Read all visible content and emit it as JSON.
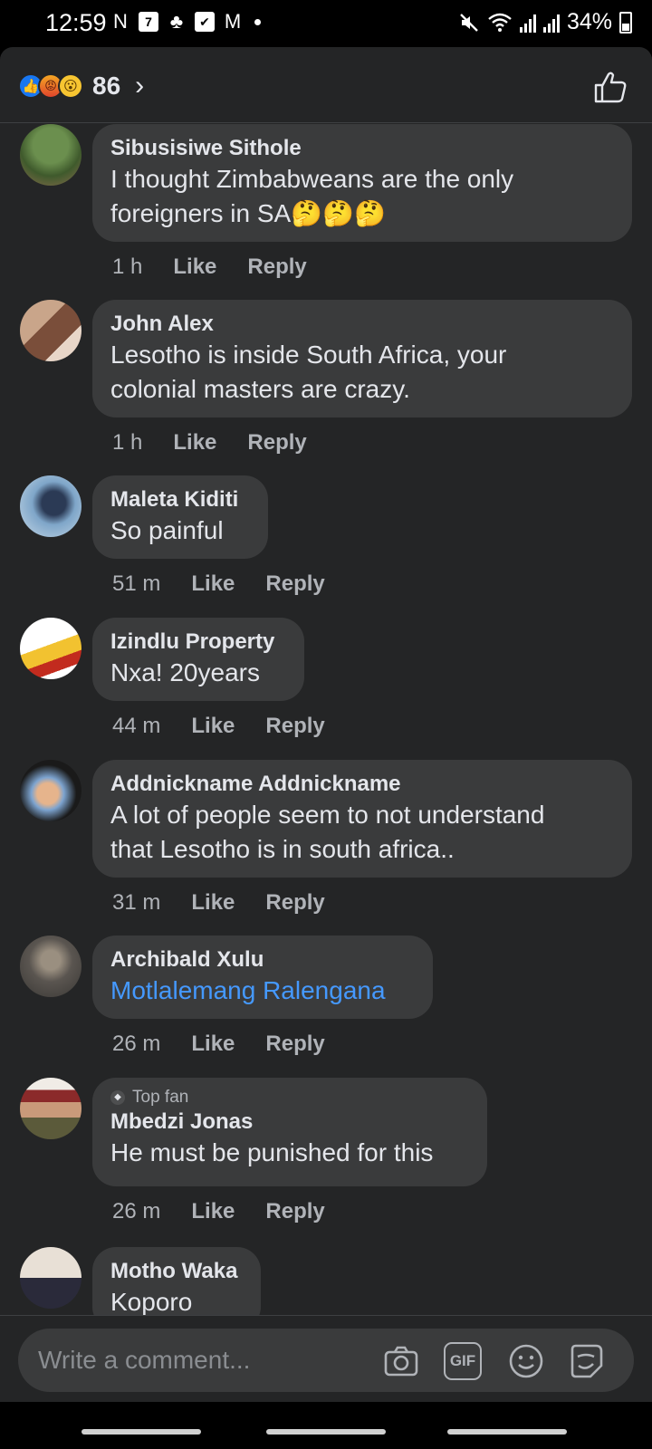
{
  "status_bar": {
    "time": "12:59",
    "battery": "34%",
    "left_icons": [
      "N",
      "7",
      "♣",
      "✔",
      "M"
    ]
  },
  "reactions": {
    "count": "86",
    "types": [
      "like-icon",
      "angry-icon",
      "wow-icon"
    ]
  },
  "comments": [
    {
      "author": "Sibusisiwe Sithole",
      "lines": [
        "I thought  Zimbabweans  are the only",
        "foreigners in  SA🤔🤔🤔"
      ],
      "time": "1 h",
      "like": "Like",
      "reply": "Reply"
    },
    {
      "author": "John Alex",
      "lines": [
        "Lesotho is inside South Africa, your",
        "colonial masters are crazy."
      ],
      "time": "1 h",
      "like": "Like",
      "reply": "Reply"
    },
    {
      "author": "Maleta Kiditi",
      "lines": [
        "So painful"
      ],
      "time": "51 m",
      "like": "Like",
      "reply": "Reply"
    },
    {
      "author": "Izindlu Property",
      "lines": [
        "Nxa! 20years"
      ],
      "time": "44 m",
      "like": "Like",
      "reply": "Reply"
    },
    {
      "author": "Addnickname Addnickname",
      "lines": [
        "A lot of people seem to not understand",
        "that Lesotho is in south africa.."
      ],
      "time": "31 m",
      "like": "Like",
      "reply": "Reply"
    },
    {
      "author": "Archibald Xulu",
      "lines": [
        "Motlalemang Ralengana"
      ],
      "time": "26 m",
      "like": "Like",
      "reply": "Reply",
      "mention": true
    },
    {
      "author": "Mbedzi Jonas",
      "badge": "Top fan",
      "lines": [
        "He must be punished for this"
      ],
      "time": "26 m",
      "like": "Like",
      "reply": "Reply"
    },
    {
      "author": "Motho Waka",
      "lines": [
        "Koporo"
      ]
    }
  ],
  "composer": {
    "placeholder": "Write a comment...",
    "icons": [
      "camera-icon",
      "gif-icon",
      "emoji-icon",
      "sticker-icon"
    ],
    "gif_label": "GIF"
  },
  "colors": {
    "sheet_bg": "#242526",
    "bubble_bg": "#3a3b3c",
    "mention": "#4599ff",
    "muted": "#b0b3b8"
  }
}
